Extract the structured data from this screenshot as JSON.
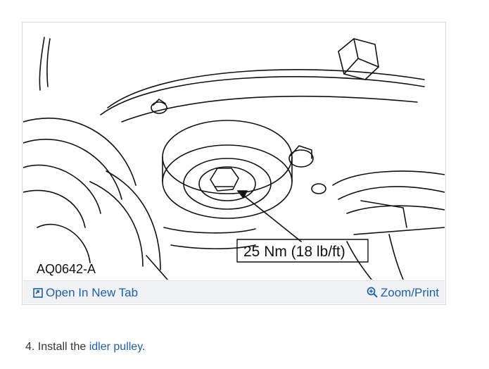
{
  "figure": {
    "figure_code": "AQ0642-A",
    "torque_callout": "25 Nm (18 lb/ft)"
  },
  "toolbar": {
    "open_tab_label": "Open In New Tab",
    "open_tab_icon": "open-external-icon",
    "zoom_label": "Zoom/Print",
    "zoom_icon": "magnifier-plus-icon",
    "link_color": "#1f5fa8"
  },
  "step": {
    "prefix": "4. Install the ",
    "link_text": "idler pulley",
    "suffix": "."
  }
}
